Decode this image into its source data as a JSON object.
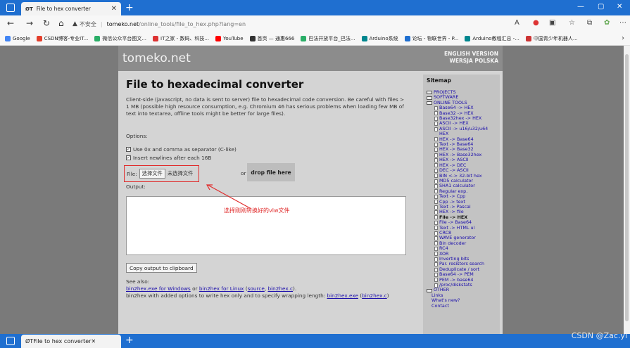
{
  "browser": {
    "tab_favicon": "ØT",
    "tab_title": "File to hex converter",
    "insecure_label": "不安全",
    "url_host": "tomeko.net",
    "url_path": "/online_tools/file_to_hex.php?lang=en"
  },
  "bookmarks": [
    {
      "label": "Google",
      "color": "#4285f4"
    },
    {
      "label": "CSDN博客-专业IT...",
      "color": "#e33e2b"
    },
    {
      "label": "微信公众平台图文...",
      "color": "#2aae67"
    },
    {
      "label": "IT之家 - 数码、科技...",
      "color": "#d33"
    },
    {
      "label": "YouTube",
      "color": "#ff0000"
    },
    {
      "label": "首页 — 通惠666",
      "color": "#333"
    },
    {
      "label": "巴法开放平台_巴法...",
      "color": "#2aae67"
    },
    {
      "label": "Arduino系统",
      "color": "#00878f"
    },
    {
      "label": "论坛 - 物联世界 - P...",
      "color": "#1f6fd0"
    },
    {
      "label": "Arduino教程汇总 -...",
      "color": "#00878f"
    },
    {
      "label": "中国青少年机器人...",
      "color": "#c33"
    }
  ],
  "site": {
    "logo": "tomeko.net",
    "lang_en": "ENGLISH VERSION",
    "lang_pl": "WERSJA POLSKA"
  },
  "main": {
    "heading": "File to hexadecimal converter",
    "description": "Client-side (javascript, no data is sent to server) file to hexadecimal code conversion. Be careful with files > 1 MB (possible high resource consumption, e.g. Chromium 46 has serious problems when loading few MB of text into textarea, offline tools might be better for large files).",
    "options_label": "Options:",
    "opt_separator": "Use 0x and comma as separator (C-like)",
    "opt_newlines": "Insert newlines after each 16B",
    "file_label": "File:",
    "file_button": "选择文件",
    "file_none": "未选择文件",
    "or": "or",
    "drop": "drop file here",
    "output_label": "Output:",
    "annotation": "选择刚刚转换好的vlw文件",
    "copy_button": "Copy output to clipboard",
    "see_also": "See also:",
    "link_win": "bin2hex.exe for Windows",
    "or2": " or ",
    "link_linux": "bin2hex for Linux",
    "link_source": "source",
    "link_bin2hexc": "bin2hex.c",
    "line2_text": "bin2hex with added options to write hex only and to specify wrapping length: ",
    "link_exe": "bin2hex.exe",
    "link_c": "bin2hex.c"
  },
  "sitemap": {
    "title": "Sitemap",
    "items": [
      {
        "label": "PROJECTS",
        "level": 0,
        "kind": "folder"
      },
      {
        "label": "SOFTWARE",
        "level": 0,
        "kind": "folder"
      },
      {
        "label": "ONLINE TOOLS",
        "level": 0,
        "kind": "folder"
      },
      {
        "label": "Base64 -> HEX",
        "level": 1
      },
      {
        "label": "Base32 -> HEX",
        "level": 1
      },
      {
        "label": "Base32hex -> HEX",
        "level": 1
      },
      {
        "label": "ASCII -> HEX",
        "level": 1
      },
      {
        "label": "ASCII -> u16/u32/u64",
        "level": 1
      },
      {
        "label": "HEX",
        "level": 1,
        "cont": true
      },
      {
        "label": "HEX -> Base64",
        "level": 1
      },
      {
        "label": "Text -> Base64",
        "level": 1
      },
      {
        "label": "HEX -> Base32",
        "level": 1
      },
      {
        "label": "HEX -> Base32hex",
        "level": 1
      },
      {
        "label": "HEX -> ASCII",
        "level": 1
      },
      {
        "label": "HEX -> DEC",
        "level": 1
      },
      {
        "label": "DEC -> ASCII",
        "level": 1
      },
      {
        "label": "BIN <-> 32-bit hex",
        "level": 1
      },
      {
        "label": "MD5 calculator",
        "level": 1
      },
      {
        "label": "SHA1 calculator",
        "level": 1
      },
      {
        "label": "Regular exp.",
        "level": 1
      },
      {
        "label": "Text -> Cpp",
        "level": 1
      },
      {
        "label": "Cpp -> text",
        "level": 1
      },
      {
        "label": "Text -> Pascal",
        "level": 1
      },
      {
        "label": "HEX -> file",
        "level": 1
      },
      {
        "label": "File -> HEX",
        "level": 1,
        "current": true
      },
      {
        "label": "File -> Base64",
        "level": 1
      },
      {
        "label": "Text -> HTML ul",
        "level": 1
      },
      {
        "label": "CRC8",
        "level": 1
      },
      {
        "label": "WAVE generator",
        "level": 1
      },
      {
        "label": "Bin decoder",
        "level": 1
      },
      {
        "label": "RC4",
        "level": 1
      },
      {
        "label": "XOR",
        "level": 1
      },
      {
        "label": "Inverting bits",
        "level": 1
      },
      {
        "label": "Par. resistors search",
        "level": 1
      },
      {
        "label": "Deduplicate / sort",
        "level": 1
      },
      {
        "label": "Base64 -> PEM",
        "level": 1
      },
      {
        "label": "PEM -> base64",
        "level": 1
      },
      {
        "label": "/proc/diskstats",
        "level": 1
      },
      {
        "label": "OTHER",
        "level": 0,
        "kind": "folder"
      },
      {
        "label": "Links",
        "level": 0,
        "kind": "plain"
      },
      {
        "label": "What's new?",
        "level": 0,
        "kind": "plain"
      },
      {
        "label": "Contact",
        "level": 0,
        "kind": "plain"
      }
    ]
  },
  "watermark": "CSDN @Zac.yi"
}
